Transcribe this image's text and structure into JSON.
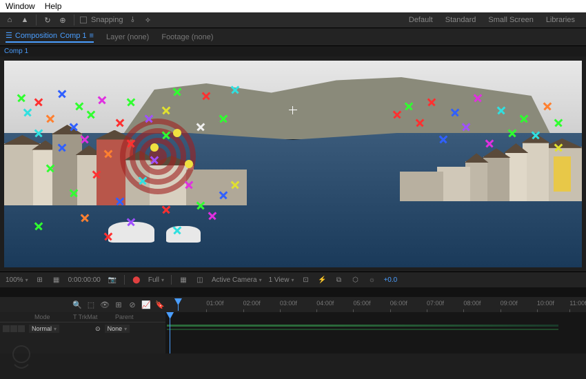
{
  "menu": {
    "window": "Window",
    "help": "Help"
  },
  "toolbar": {
    "snapping_label": "Snapping"
  },
  "workspaces": {
    "default": "Default",
    "standard": "Standard",
    "small": "Small Screen",
    "libraries": "Libraries"
  },
  "panel_tabs": {
    "composition_label": "Composition",
    "comp_name": "Comp 1",
    "layer_label": "Layer (none)",
    "footage_label": "Footage (none)"
  },
  "comp_header": "Comp 1",
  "viewer_controls": {
    "zoom": "100%",
    "timecode": "0:00:00:00",
    "resolution": "Full",
    "camera": "Active Camera",
    "views": "1 View",
    "exposure": "+0.0"
  },
  "timeline": {
    "ticks": [
      "01:00f",
      "02:00f",
      "03:00f",
      "04:00f",
      "05:00f",
      "06:00f",
      "07:00f",
      "08:00f",
      "09:00f",
      "10:00f",
      "11:00f"
    ],
    "columns": {
      "mode": "Mode",
      "trkmat": "T  TrkMat",
      "parent": "Parent"
    },
    "layer": {
      "mode_value": "Normal",
      "parent_value": "None"
    }
  }
}
